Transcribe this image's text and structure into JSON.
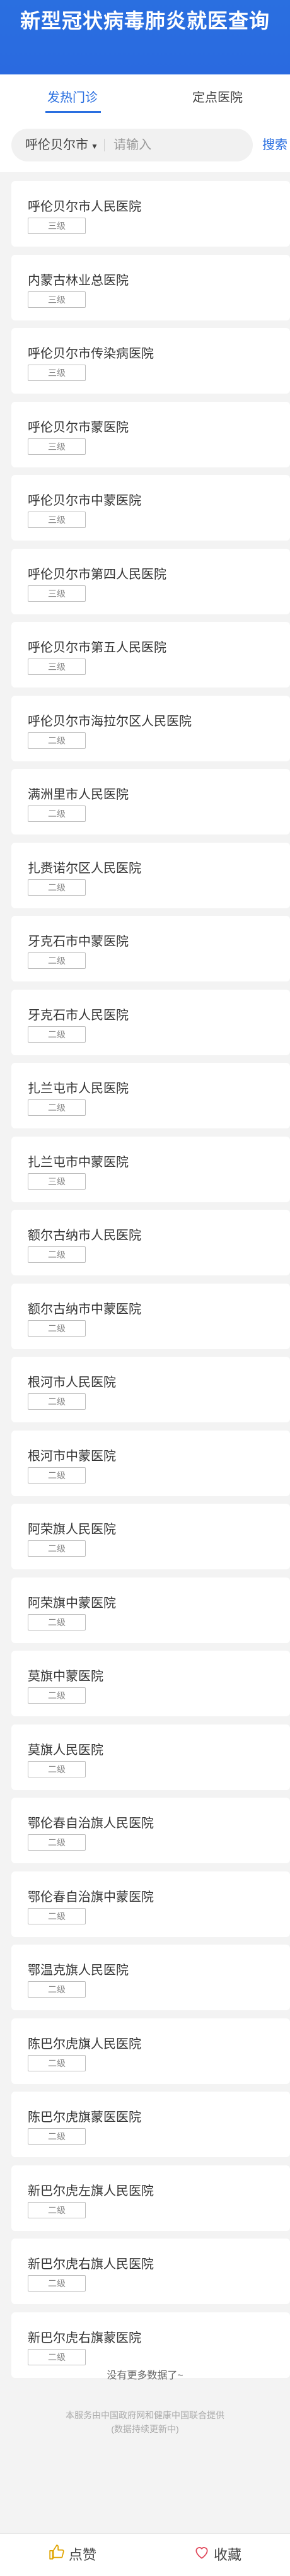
{
  "header": {
    "title": "新型冠状病毒肺炎就医查询"
  },
  "tabs": [
    {
      "label": "发热门诊",
      "active": true
    },
    {
      "label": "定点医院",
      "active": false
    }
  ],
  "search": {
    "city": "呼伦贝尔市",
    "placeholder": "请输入",
    "button_label": "搜索"
  },
  "hospitals": [
    {
      "name": "呼伦贝尔市人民医院",
      "level": "三级"
    },
    {
      "name": "内蒙古林业总医院",
      "level": "三级"
    },
    {
      "name": "呼伦贝尔市传染病医院",
      "level": "三级"
    },
    {
      "name": "呼伦贝尔市蒙医院",
      "level": "三级"
    },
    {
      "name": "呼伦贝尔市中蒙医院",
      "level": "三级"
    },
    {
      "name": "呼伦贝尔市第四人民医院",
      "level": "三级"
    },
    {
      "name": "呼伦贝尔市第五人民医院",
      "level": "三级"
    },
    {
      "name": "呼伦贝尔市海拉尔区人民医院",
      "level": "二级"
    },
    {
      "name": "满洲里市人民医院",
      "level": "二级"
    },
    {
      "name": "扎赉诺尔区人民医院",
      "level": "二级"
    },
    {
      "name": "牙克石市中蒙医院",
      "level": "二级"
    },
    {
      "name": "牙克石市人民医院",
      "level": "二级"
    },
    {
      "name": "扎兰屯市人民医院",
      "level": "二级"
    },
    {
      "name": "扎兰屯市中蒙医院",
      "level": "三级"
    },
    {
      "name": "额尔古纳市人民医院",
      "level": "二级"
    },
    {
      "name": "额尔古纳市中蒙医院",
      "level": "二级"
    },
    {
      "name": "根河市人民医院",
      "level": "二级"
    },
    {
      "name": "根河市中蒙医院",
      "level": "二级"
    },
    {
      "name": "阿荣旗人民医院",
      "level": "二级"
    },
    {
      "name": "阿荣旗中蒙医院",
      "level": "二级"
    },
    {
      "name": "莫旗中蒙医院",
      "level": "二级"
    },
    {
      "name": "莫旗人民医院",
      "level": "二级"
    },
    {
      "name": "鄂伦春自治旗人民医院",
      "level": "二级"
    },
    {
      "name": "鄂伦春自治旗中蒙医院",
      "level": "二级"
    },
    {
      "name": "鄂温克旗人民医院",
      "level": "二级"
    },
    {
      "name": "陈巴尔虎旗人民医院",
      "level": "二级"
    },
    {
      "name": "陈巴尔虎旗蒙医医院",
      "level": "二级"
    },
    {
      "name": "新巴尔虎左旗人民医院",
      "level": "二级"
    },
    {
      "name": "新巴尔虎右旗人民医院",
      "level": "二级"
    },
    {
      "name": "新巴尔虎右旗蒙医院",
      "level": "二级"
    }
  ],
  "footer": {
    "no_more": "没有更多数据了~",
    "note_line1": "本服务由中国政府网和健康中国联合提供",
    "note_line2": "(数据持续更新中)"
  },
  "bottom_bar": {
    "like_label": "点赞",
    "favorite_label": "收藏",
    "accent": "#2a6fe0"
  }
}
